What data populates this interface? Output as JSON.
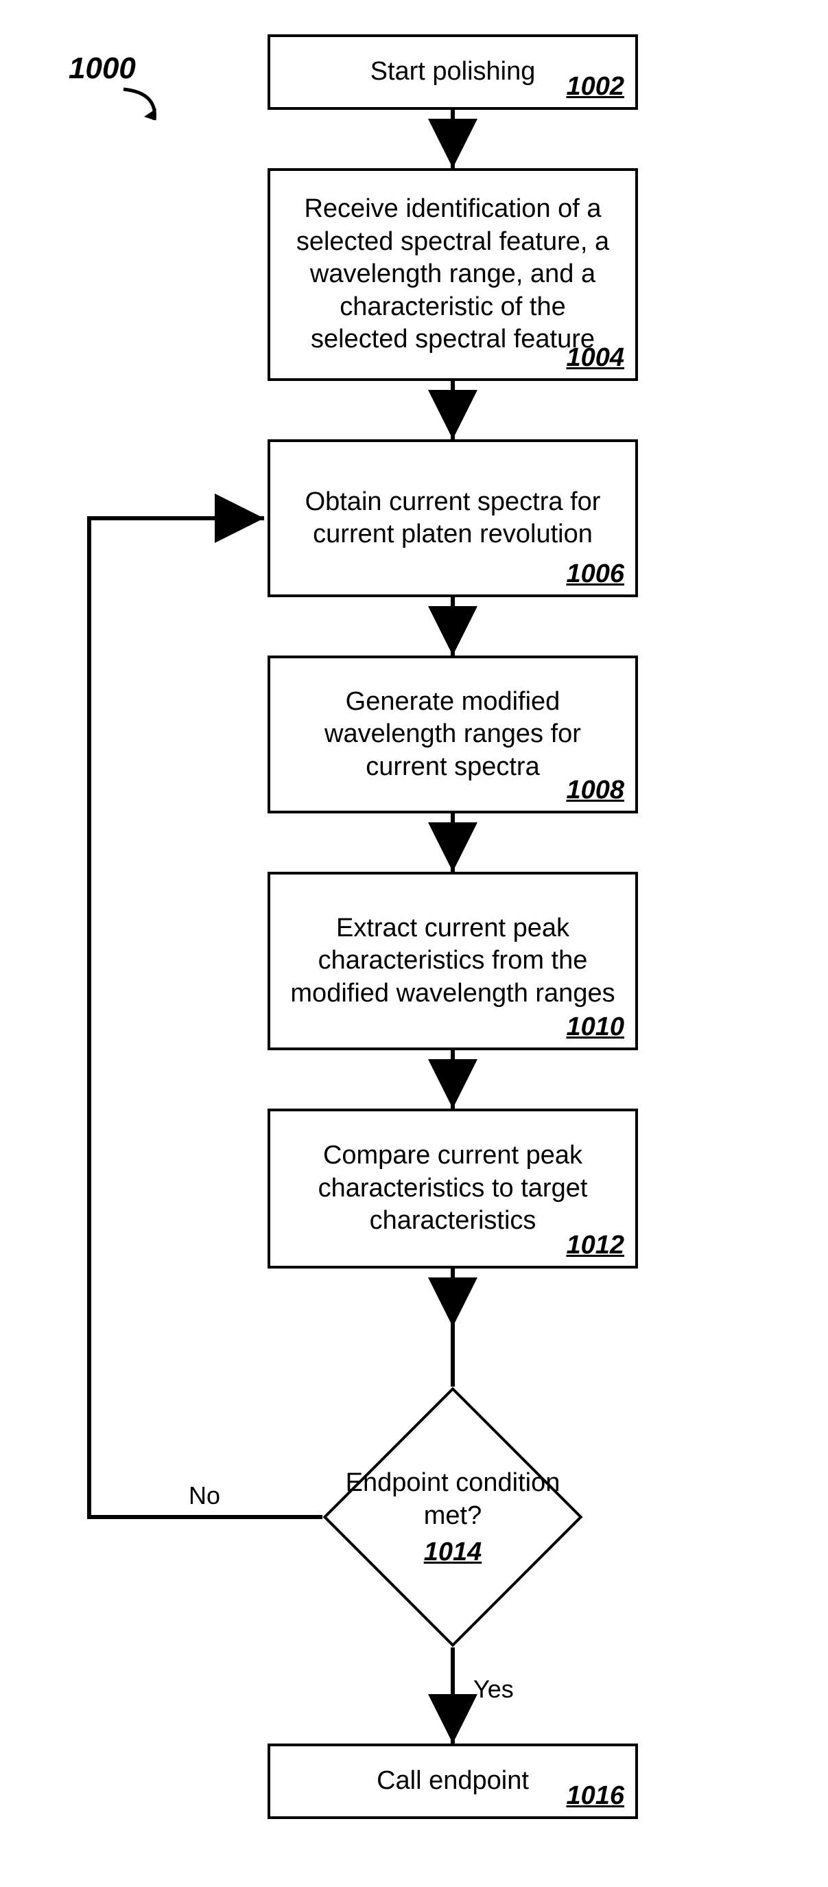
{
  "figure_ref": "1000",
  "steps": {
    "s1002": {
      "text": "Start polishing",
      "num": "1002"
    },
    "s1004": {
      "text": "Receive identification of a selected spectral feature, a wavelength range, and a characteristic of the selected spectral feature",
      "num": "1004"
    },
    "s1006": {
      "text": "Obtain current spectra for current platen revolution",
      "num": "1006"
    },
    "s1008": {
      "text": "Generate modified wavelength ranges for current spectra",
      "num": "1008"
    },
    "s1010": {
      "text": "Extract current peak characteristics from the modified wavelength ranges",
      "num": "1010"
    },
    "s1012": {
      "text": "Compare current peak characteristics to target characteristics",
      "num": "1012"
    },
    "s1014": {
      "text": "Endpoint condition met?",
      "num": "1014"
    },
    "s1016": {
      "text": "Call endpoint",
      "num": "1016"
    }
  },
  "edges": {
    "no": "No",
    "yes": "Yes"
  }
}
